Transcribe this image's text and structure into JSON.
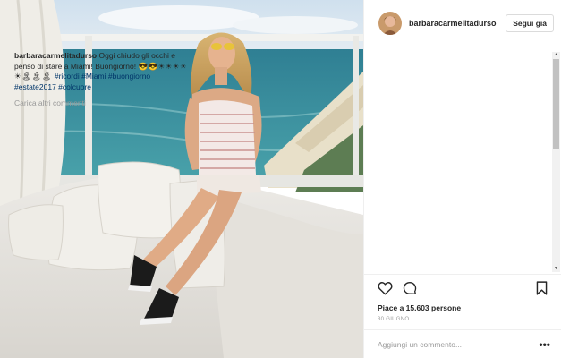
{
  "post": {
    "username": "barbaracarmelitadurso",
    "follow_label": "Segui già",
    "caption_user": "barbaracarmelitadurso",
    "caption_text": " Oggi chiudo gli occhi e penso di stare a Miami! Buongiorno! ",
    "caption_emoji": "😎😎☀☀☀☀☀🏝🏝🏝 ",
    "hashtags": [
      "#ricordi",
      "#Miami",
      "#buongiorno",
      "#estate2017",
      "#colcuore"
    ],
    "load_more": "Carica altri commenti",
    "likes": "Piace a 15.603 persone",
    "date": "30 GIUGNO",
    "comment_placeholder": "Aggiungi un commento...",
    "more_label": "•••"
  },
  "icons": {
    "like": "heart-icon",
    "comment": "comment-icon",
    "save": "bookmark-icon",
    "more": "more-icon"
  },
  "colors": {
    "hashtag": "#003569",
    "secondary_text": "#999999",
    "border": "#efefef"
  }
}
